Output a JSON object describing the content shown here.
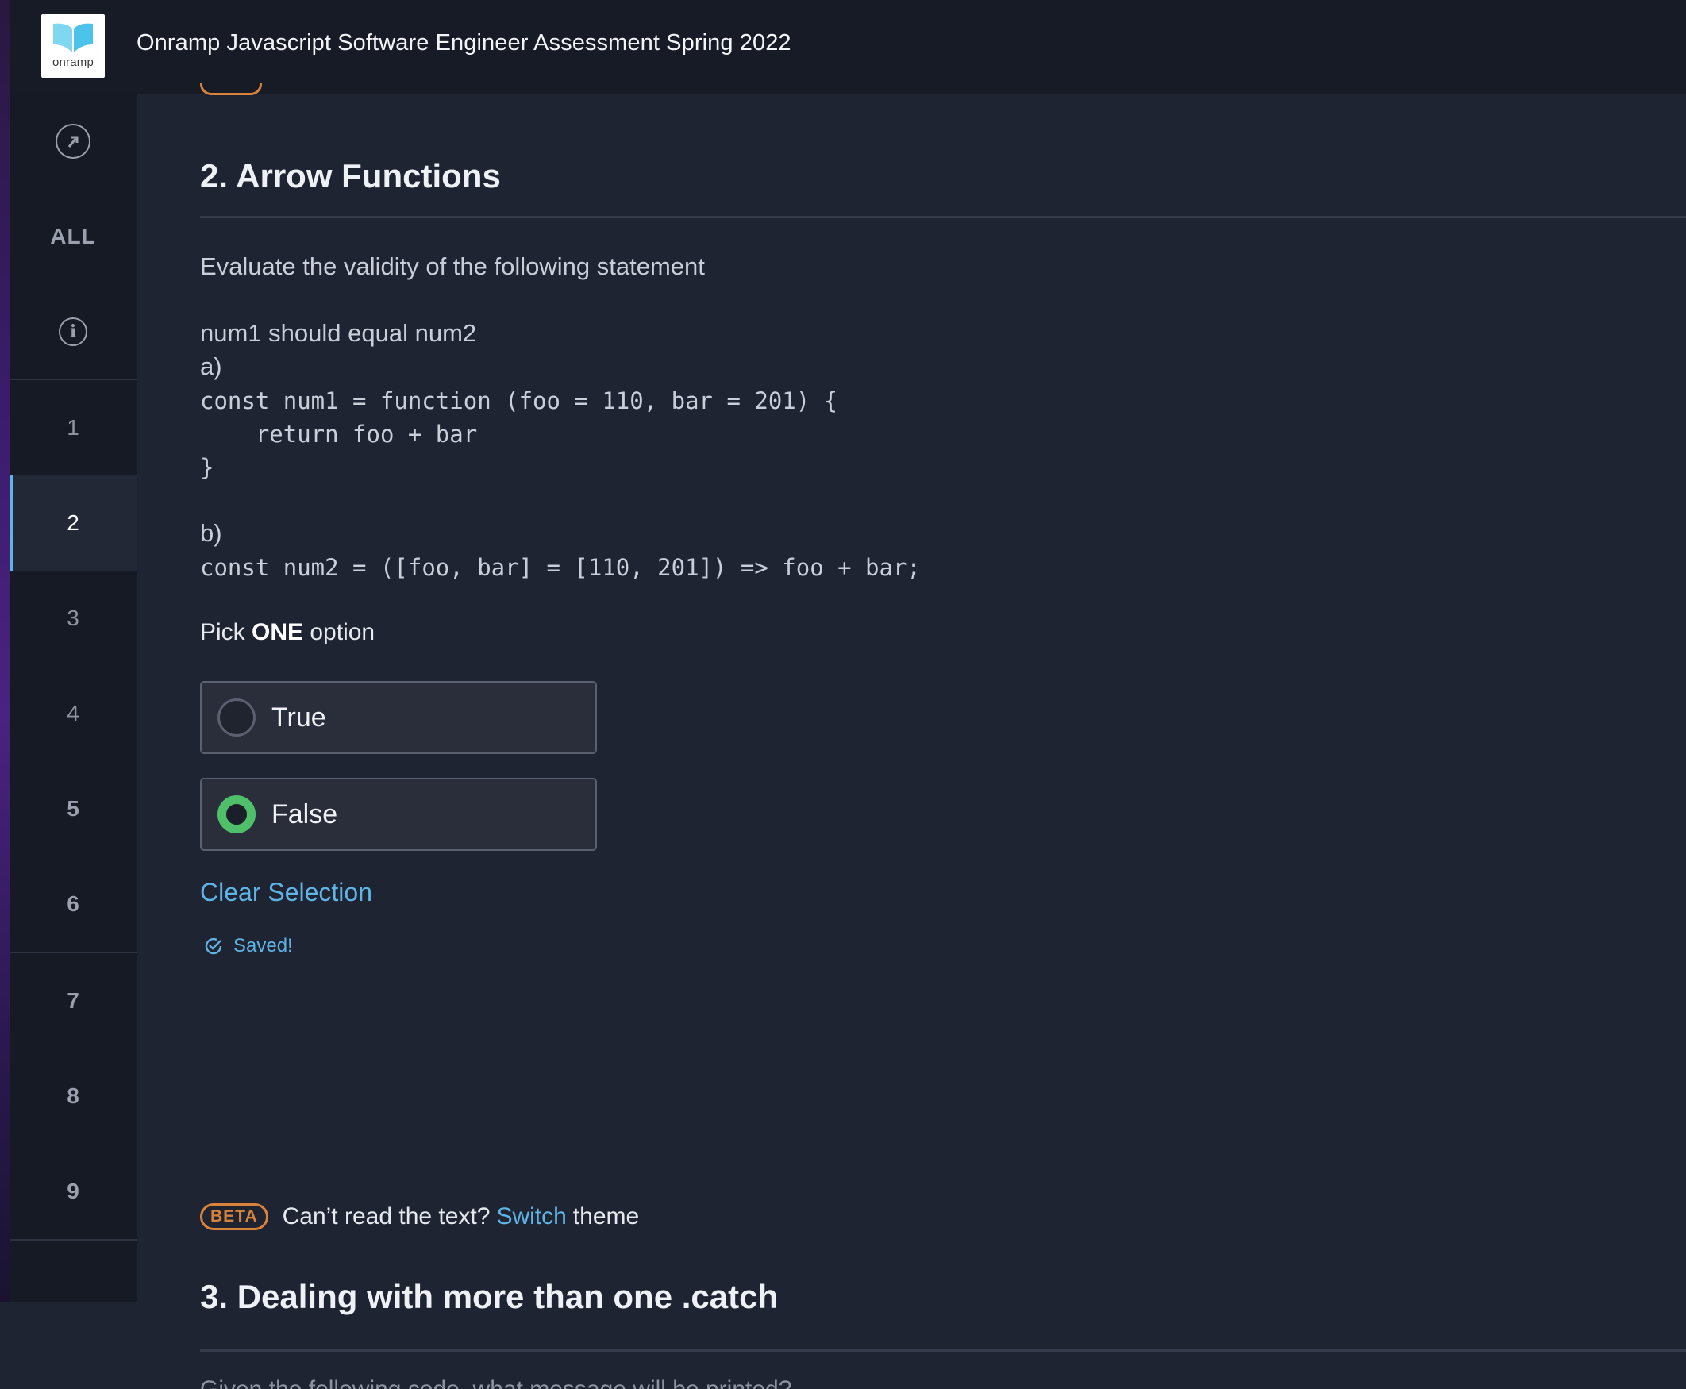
{
  "header": {
    "logo_text": "onramp",
    "title": "Onramp Javascript Software Engineer Assessment Spring 2022"
  },
  "sidebar": {
    "nav_icon": "arrow-circle-icon",
    "all_label": "ALL",
    "info_icon": "info-icon",
    "items": [
      "1",
      "2",
      "3",
      "4",
      "5",
      "6",
      "7",
      "8",
      "9"
    ],
    "active_item": "2"
  },
  "question": {
    "title": "2. Arrow Functions",
    "prompt": "Evaluate the validity of the following statement",
    "statement": "num1 should equal num2",
    "part_a_label": "a)",
    "code_a_line1": "const num1 = function (foo = 110, bar = 201) {",
    "code_a_line2": "    return foo + bar",
    "code_a_line3": "}",
    "part_b_label": "b)",
    "code_b_line1": "const num2 = ([foo, bar] = [110, 201]) => foo + bar;",
    "pick_prefix": "Pick ",
    "pick_strong": "ONE",
    "pick_suffix": " option",
    "options": [
      {
        "label": "True",
        "selected": false
      },
      {
        "label": "False",
        "selected": true
      }
    ],
    "clear_label": "Clear Selection",
    "saved_label": "Saved!"
  },
  "theme_notice": {
    "badge": "BETA",
    "text_before": "Can’t read the text?",
    "link": "Switch",
    "text_after": "theme"
  },
  "next_question": {
    "title": "3. Dealing with more than one .catch",
    "preview": "Given the following code, what message will be printed?"
  },
  "colors": {
    "accent": "#5fb4e6",
    "selected_radio": "#4fbf6a",
    "beta": "#d9823a"
  }
}
